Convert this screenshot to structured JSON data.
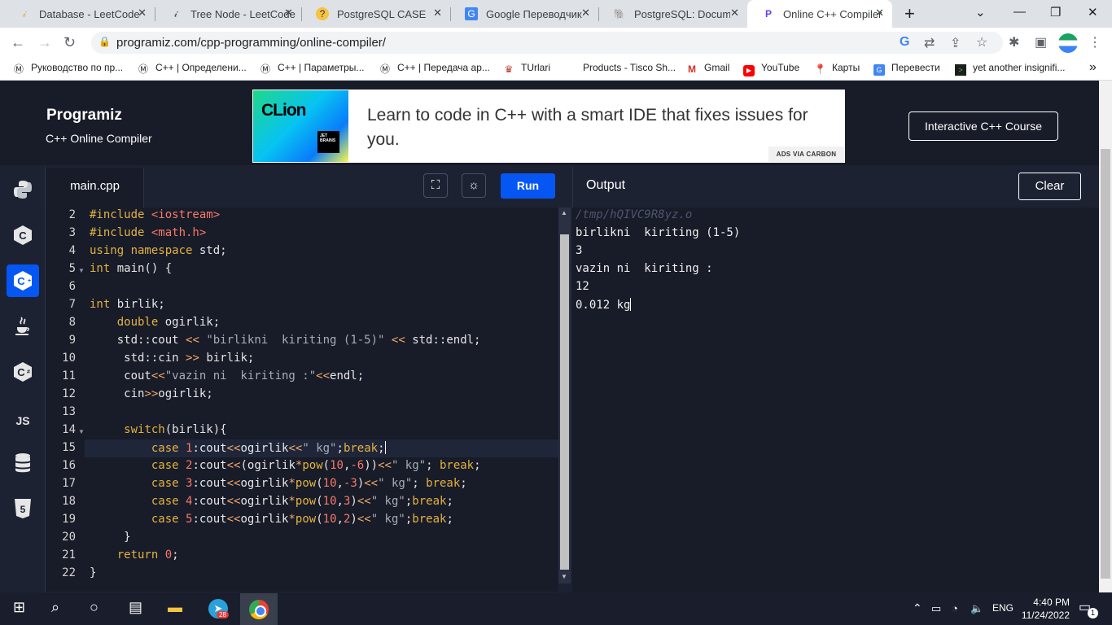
{
  "browser": {
    "tabs": [
      {
        "title": "Database - LeetCode",
        "icon": "leetcode-icon"
      },
      {
        "title": "Tree Node - LeetCode",
        "icon": "leetcode-icon"
      },
      {
        "title": "PostgreSQL CASE",
        "icon": "postgres-case-icon"
      },
      {
        "title": "Google Переводчик",
        "icon": "google-translate-icon"
      },
      {
        "title": "PostgreSQL: Documen",
        "icon": "postgresql-icon"
      },
      {
        "title": "Online C++ Compiler",
        "icon": "programiz-icon",
        "active": true
      }
    ],
    "url": "programiz.com/cpp-programming/online-compiler/",
    "bookmarks": [
      "Руководство по пр...",
      "C++ | Определени...",
      "C++ | Параметры...",
      "C++ | Передача ар...",
      "TUrlari",
      "Products - Tisco Sh...",
      "Gmail",
      "YouTube",
      "Карты",
      "Перевести",
      "yet another insignifi..."
    ]
  },
  "header": {
    "logo": "Programiz",
    "subtitle": "C++ Online Compiler",
    "ad_brand": "CLion",
    "ad_jb": "JET BRAINS",
    "ad_text": "Learn to code in C++ with a smart IDE that fixes issues for you.",
    "ad_label": "ADS VIA CARBON",
    "course_button": "Interactive C++ Course"
  },
  "rail": [
    "python-icon",
    "c-icon",
    "cpp-icon",
    "java-icon",
    "csharp-icon",
    "JS",
    "database-icon",
    "html5-icon"
  ],
  "editor": {
    "filename": "main.cpp",
    "run_label": "Run",
    "line_numbers": [
      "2",
      "3",
      "4",
      "5",
      "6",
      "7",
      "8",
      "9",
      "10",
      "11",
      "12",
      "13",
      "14",
      "15",
      "16",
      "17",
      "18",
      "19",
      "20",
      "21",
      "22"
    ]
  },
  "output": {
    "title": "Output",
    "clear_label": "Clear",
    "lines": [
      "/tmp/hQIVC9R8yz.o",
      "birlikni  kiriting (1-5)",
      "3",
      "vazin ni  kiriting :",
      "12",
      "0.012 kg"
    ]
  },
  "taskbar": {
    "lang": "ENG",
    "time": "4:40 PM",
    "date": "11/24/2022",
    "telegram_badge": "28",
    "notification_count": "1"
  }
}
